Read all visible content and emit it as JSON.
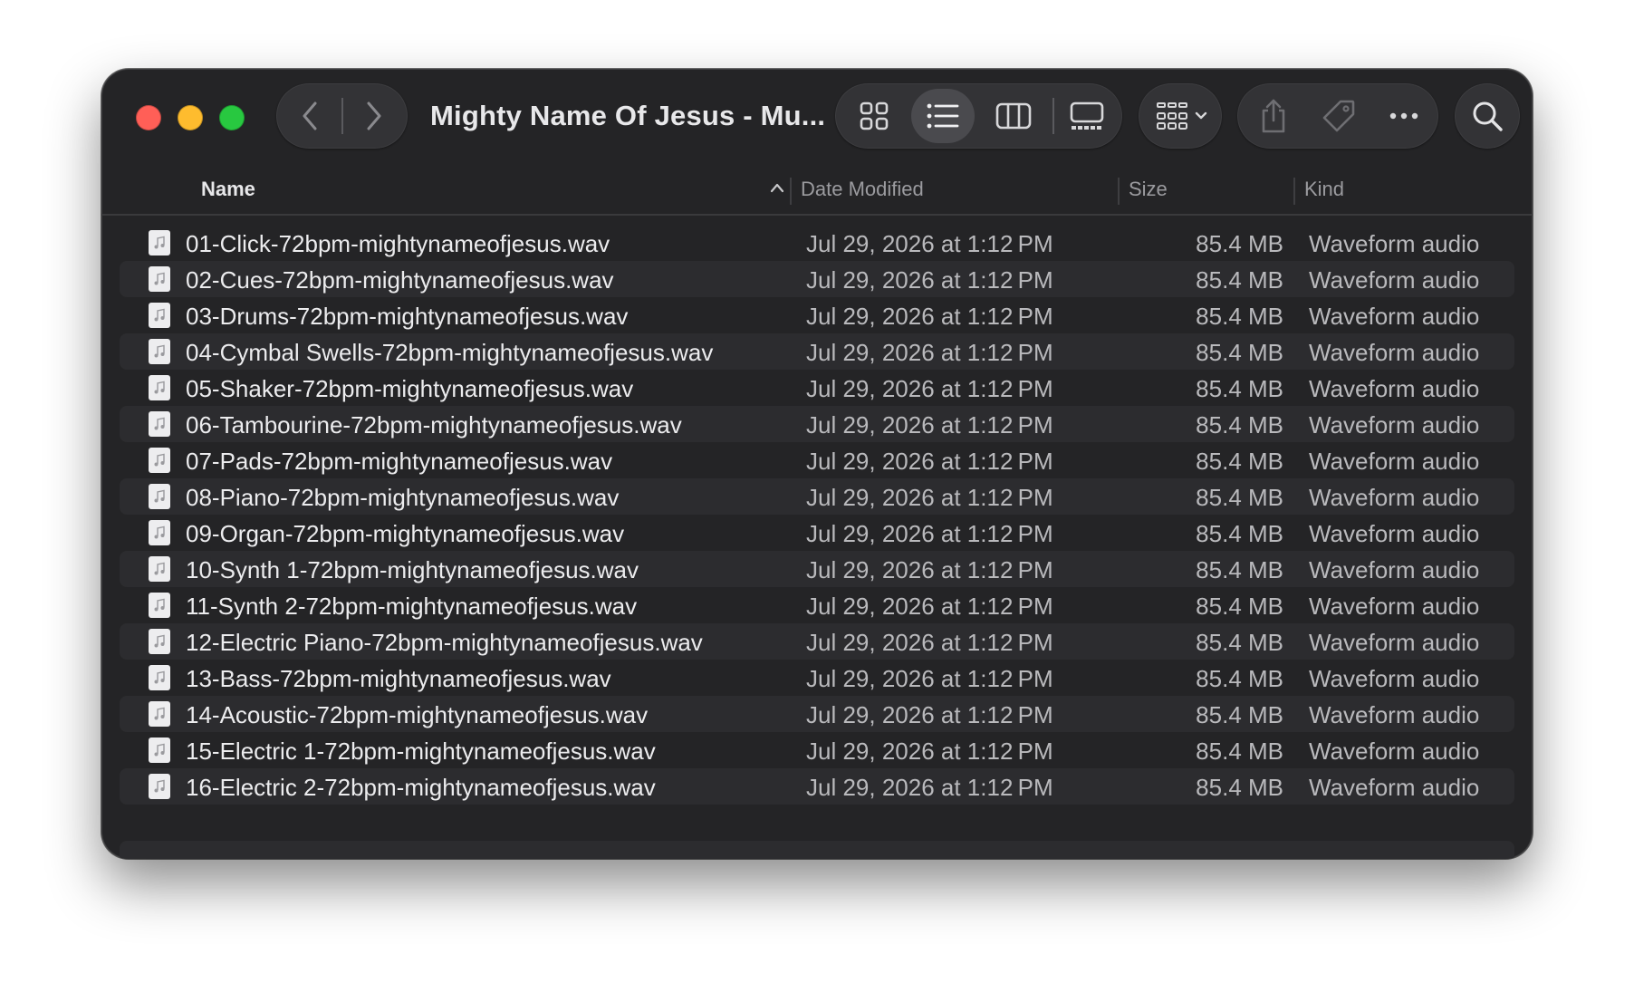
{
  "window": {
    "title": "Mighty Name Of Jesus - Mu...",
    "traffic_lights": {
      "close": "#ff5f57",
      "minimize": "#febc2e",
      "maximize": "#28c840"
    }
  },
  "toolbar": {
    "back_icon": "chevron-left-icon",
    "forward_icon": "chevron-right-icon",
    "view_modes": [
      "icon-view",
      "list-view",
      "column-view",
      "gallery-view"
    ],
    "selected_view": "list-view",
    "group_icon": "group-grid-icon",
    "actions": [
      "share-icon",
      "tag-icon",
      "more-icon"
    ],
    "search_icon": "search-icon"
  },
  "columns": {
    "name": "Name",
    "date": "Date Modified",
    "size": "Size",
    "kind": "Kind",
    "sort_icon": "chevron-up-icon"
  },
  "files": [
    {
      "name": "01-Click-72bpm-mightynameofjesus.wav",
      "date": "Jul 29, 2026 at 1:12 PM",
      "size": "85.4 MB",
      "kind": "Waveform audio"
    },
    {
      "name": "02-Cues-72bpm-mightynameofjesus.wav",
      "date": "Jul 29, 2026 at 1:12 PM",
      "size": "85.4 MB",
      "kind": "Waveform audio"
    },
    {
      "name": "03-Drums-72bpm-mightynameofjesus.wav",
      "date": "Jul 29, 2026 at 1:12 PM",
      "size": "85.4 MB",
      "kind": "Waveform audio"
    },
    {
      "name": "04-Cymbal Swells-72bpm-mightynameofjesus.wav",
      "date": "Jul 29, 2026 at 1:12 PM",
      "size": "85.4 MB",
      "kind": "Waveform audio"
    },
    {
      "name": "05-Shaker-72bpm-mightynameofjesus.wav",
      "date": "Jul 29, 2026 at 1:12 PM",
      "size": "85.4 MB",
      "kind": "Waveform audio"
    },
    {
      "name": "06-Tambourine-72bpm-mightynameofjesus.wav",
      "date": "Jul 29, 2026 at 1:12 PM",
      "size": "85.4 MB",
      "kind": "Waveform audio"
    },
    {
      "name": "07-Pads-72bpm-mightynameofjesus.wav",
      "date": "Jul 29, 2026 at 1:12 PM",
      "size": "85.4 MB",
      "kind": "Waveform audio"
    },
    {
      "name": "08-Piano-72bpm-mightynameofjesus.wav",
      "date": "Jul 29, 2026 at 1:12 PM",
      "size": "85.4 MB",
      "kind": "Waveform audio"
    },
    {
      "name": "09-Organ-72bpm-mightynameofjesus.wav",
      "date": "Jul 29, 2026 at 1:12 PM",
      "size": "85.4 MB",
      "kind": "Waveform audio"
    },
    {
      "name": "10-Synth 1-72bpm-mightynameofjesus.wav",
      "date": "Jul 29, 2026 at 1:12 PM",
      "size": "85.4 MB",
      "kind": "Waveform audio"
    },
    {
      "name": "11-Synth 2-72bpm-mightynameofjesus.wav",
      "date": "Jul 29, 2026 at 1:12 PM",
      "size": "85.4 MB",
      "kind": "Waveform audio"
    },
    {
      "name": "12-Electric Piano-72bpm-mightynameofjesus.wav",
      "date": "Jul 29, 2026 at 1:12 PM",
      "size": "85.4 MB",
      "kind": "Waveform audio"
    },
    {
      "name": "13-Bass-72bpm-mightynameofjesus.wav",
      "date": "Jul 29, 2026 at 1:12 PM",
      "size": "85.4 MB",
      "kind": "Waveform audio"
    },
    {
      "name": "14-Acoustic-72bpm-mightynameofjesus.wav",
      "date": "Jul 29, 2026 at 1:12 PM",
      "size": "85.4 MB",
      "kind": "Waveform audio"
    },
    {
      "name": "15-Electric 1-72bpm-mightynameofjesus.wav",
      "date": "Jul 29, 2026 at 1:12 PM",
      "size": "85.4 MB",
      "kind": "Waveform audio"
    },
    {
      "name": "16-Electric 2-72bpm-mightynameofjesus.wav",
      "date": "Jul 29, 2026 at 1:12 PM",
      "size": "85.4 MB",
      "kind": "Waveform audio"
    }
  ]
}
